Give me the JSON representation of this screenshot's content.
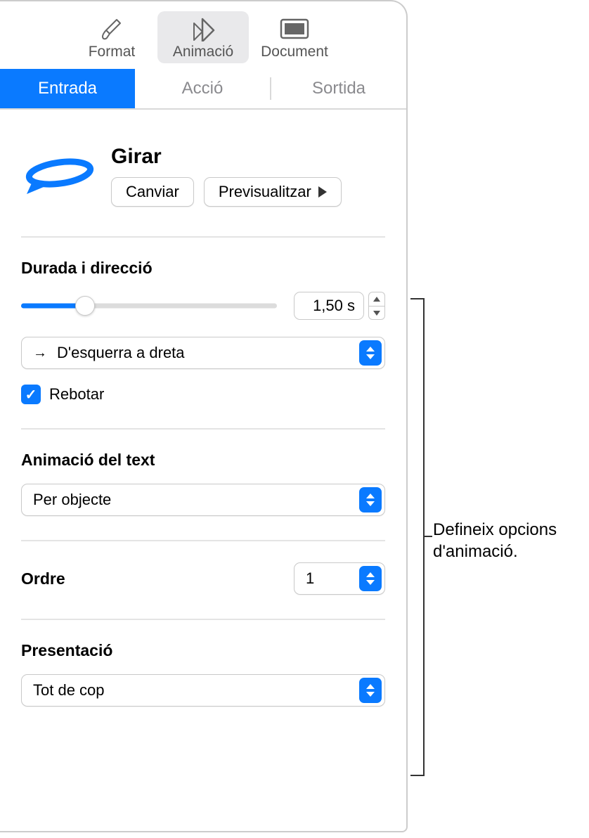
{
  "toolbar": {
    "format": "Format",
    "animate": "Animació",
    "document": "Document"
  },
  "tabs": {
    "build_in": "Entrada",
    "action": "Acció",
    "build_out": "Sortida"
  },
  "effect": {
    "name": "Girar",
    "change_btn": "Canviar",
    "preview_btn": "Previsualitzar"
  },
  "duration": {
    "title": "Durada i direcció",
    "value": "1,50 s",
    "direction": "D'esquerra a dreta",
    "bounce": "Rebotar"
  },
  "text_anim": {
    "title": "Animació del text",
    "value": "Per objecte"
  },
  "order": {
    "title": "Ordre",
    "value": "1"
  },
  "delivery": {
    "title": "Presentació",
    "value": "Tot de cop"
  },
  "callout": {
    "line1": "Defineix opcions",
    "line2": "d'animació."
  }
}
